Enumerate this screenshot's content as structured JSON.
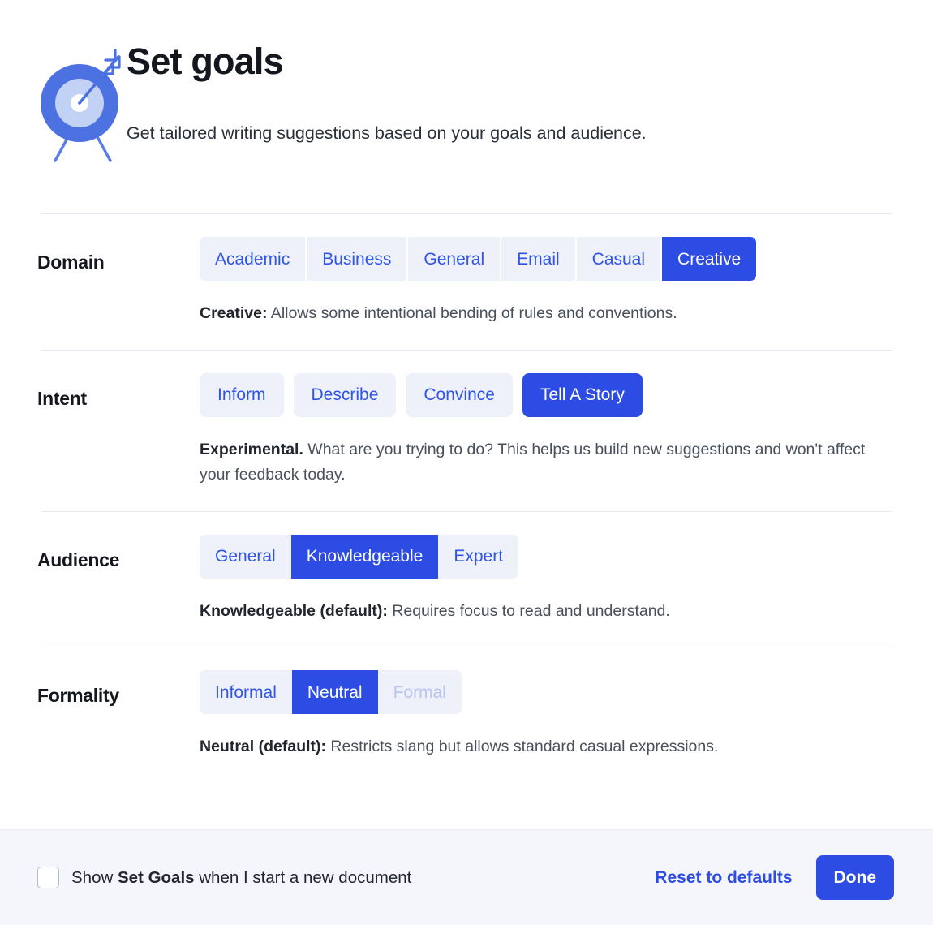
{
  "header": {
    "icon": "target-bullseye-arrow-icon",
    "title": "Set goals",
    "subtitle": "Get tailored writing suggestions based on your goals and audience."
  },
  "colors": {
    "accent": "#2d4ce3",
    "option_bg": "#eef0fa",
    "option_text": "#2f55e8",
    "option_disabled_text": "#b9c4ef",
    "footer_bg": "#f5f6fb",
    "divider": "#e7eaf2",
    "heading": "#15171f",
    "body_text": "#4a4f5c"
  },
  "sections": [
    {
      "label": "Domain",
      "style": "gapped",
      "options": [
        {
          "label": "Academic",
          "selected": false,
          "disabled": false
        },
        {
          "label": "Business",
          "selected": false,
          "disabled": false
        },
        {
          "label": "General",
          "selected": false,
          "disabled": false
        },
        {
          "label": "Email",
          "selected": false,
          "disabled": false
        },
        {
          "label": "Casual",
          "selected": false,
          "disabled": false
        },
        {
          "label": "Creative",
          "selected": true,
          "disabled": false
        }
      ],
      "description_strong": "Creative:",
      "description_rest": " Allows some intentional bending of rules and conventions."
    },
    {
      "label": "Intent",
      "style": "pills",
      "options": [
        {
          "label": "Inform",
          "selected": false,
          "disabled": false
        },
        {
          "label": "Describe",
          "selected": false,
          "disabled": false
        },
        {
          "label": "Convince",
          "selected": false,
          "disabled": false
        },
        {
          "label": "Tell A Story",
          "selected": true,
          "disabled": false
        }
      ],
      "description_strong": "Experimental.",
      "description_rest": " What are you trying to do? This helps us build new suggestions and won't affect your feedback today."
    },
    {
      "label": "Audience",
      "style": "segmented",
      "options": [
        {
          "label": "General",
          "selected": false,
          "disabled": false
        },
        {
          "label": "Knowledgeable",
          "selected": true,
          "disabled": false
        },
        {
          "label": "Expert",
          "selected": false,
          "disabled": false
        }
      ],
      "description_strong": "Knowledgeable (default):",
      "description_rest": " Requires focus to read and understand."
    },
    {
      "label": "Formality",
      "style": "segmented",
      "options": [
        {
          "label": "Informal",
          "selected": false,
          "disabled": false
        },
        {
          "label": "Neutral",
          "selected": true,
          "disabled": false
        },
        {
          "label": "Formal",
          "selected": false,
          "disabled": true
        }
      ],
      "description_strong": "Neutral (default):",
      "description_rest": " Restricts slang but allows standard casual expressions."
    }
  ],
  "footer": {
    "checkbox_checked": false,
    "checkbox_label_prefix": "Show ",
    "checkbox_label_strong": "Set Goals",
    "checkbox_label_suffix": " when I start a new document",
    "reset_label": "Reset to defaults",
    "done_label": "Done"
  }
}
